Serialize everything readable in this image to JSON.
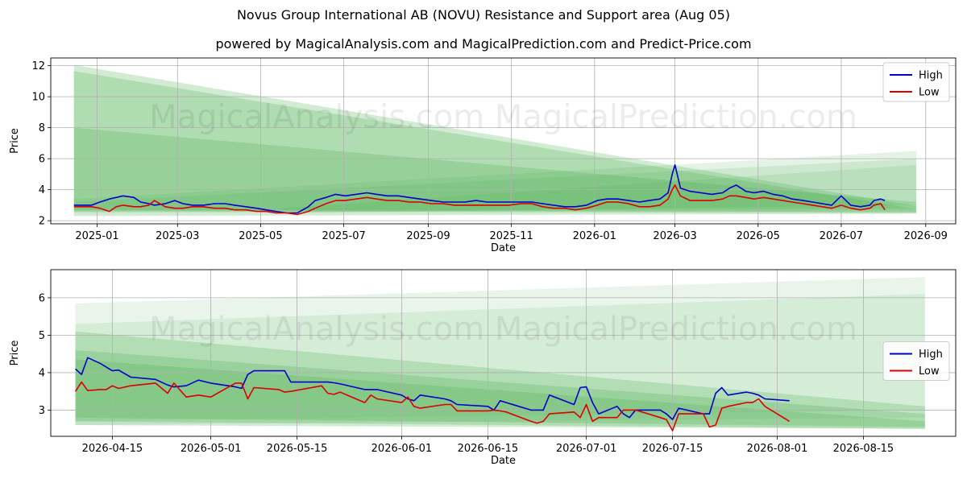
{
  "header": {
    "title": "Novus Group International AB (NOVU) Resistance and Support area (Aug 05)",
    "subtitle": "powered by MagicalAnalysis.com and MagicalPrediction.com and Predict-Price.com"
  },
  "watermark": "MagicalAnalysis.com   MagicalPrediction.com",
  "colors": {
    "high": "#0000cc",
    "low": "#dd0000",
    "band": "#4caf50",
    "grid": "#b0b0b0"
  },
  "chart_data": [
    {
      "type": "line",
      "title": "",
      "xlabel": "Date",
      "ylabel": "Price",
      "xlim": [
        "2024-11-28",
        "2026-09-23"
      ],
      "ylim": [
        1.8,
        12.5
      ],
      "x_ticks": [
        "2025-01",
        "2025-03",
        "2025-05",
        "2025-07",
        "2025-09",
        "2025-11",
        "2026-01",
        "2026-03",
        "2026-05",
        "2026-07",
        "2026-09"
      ],
      "y_ticks": [
        2,
        4,
        6,
        8,
        10,
        12
      ],
      "grid": true,
      "legend": "upper right",
      "bands": [
        {
          "x": [
            "2024-12-15",
            "2026-08-25"
          ],
          "upper": [
            12.05,
            2.95
          ],
          "lower": [
            2.3,
            2.45
          ],
          "opacity": 0.25
        },
        {
          "x": [
            "2024-12-15",
            "2026-08-25"
          ],
          "upper": [
            11.65,
            2.75
          ],
          "lower": [
            2.6,
            2.5
          ],
          "opacity": 0.25
        },
        {
          "x": [
            "2024-12-15",
            "2026-08-25"
          ],
          "upper": [
            8.0,
            3.2
          ],
          "lower": [
            2.7,
            2.55
          ],
          "opacity": 0.25
        },
        {
          "x": [
            "2024-12-15",
            "2026-08-25"
          ],
          "upper": [
            3.4,
            6.5
          ],
          "lower": [
            2.6,
            2.8
          ],
          "opacity": 0.15
        },
        {
          "x": [
            "2024-12-15",
            "2026-08-25"
          ],
          "upper": [
            3.2,
            6.0
          ],
          "lower": [
            2.5,
            2.7
          ],
          "opacity": 0.15
        },
        {
          "x": [
            "2025-05-15",
            "2026-08-25"
          ],
          "upper": [
            2.8,
            5.6
          ],
          "lower": [
            2.5,
            3.0
          ],
          "opacity": 0.15
        }
      ],
      "series": [
        {
          "name": "High",
          "x": [
            "2024-12-15",
            "2024-12-20",
            "2024-12-28",
            "2025-01-03",
            "2025-01-10",
            "2025-01-15",
            "2025-01-20",
            "2025-01-28",
            "2025-02-02",
            "2025-02-08",
            "2025-02-12",
            "2025-02-20",
            "2025-02-27",
            "2025-03-05",
            "2025-03-12",
            "2025-03-20",
            "2025-03-28",
            "2025-04-05",
            "2025-04-12",
            "2025-04-20",
            "2025-04-28",
            "2025-05-05",
            "2025-05-12",
            "2025-05-20",
            "2025-05-28",
            "2025-06-05",
            "2025-06-10",
            "2025-06-18",
            "2025-06-25",
            "2025-07-02",
            "2025-07-10",
            "2025-07-18",
            "2025-07-25",
            "2025-08-02",
            "2025-08-10",
            "2025-08-18",
            "2025-08-26",
            "2025-09-03",
            "2025-09-12",
            "2025-09-20",
            "2025-09-28",
            "2025-10-06",
            "2025-10-14",
            "2025-10-22",
            "2025-10-30",
            "2025-11-08",
            "2025-11-16",
            "2025-11-24",
            "2025-12-02",
            "2025-12-10",
            "2025-12-18",
            "2025-12-26",
            "2026-01-03",
            "2026-01-10",
            "2026-01-18",
            "2026-01-26",
            "2026-02-03",
            "2026-02-10",
            "2026-02-18",
            "2026-02-24",
            "2026-02-27",
            "2026-03-01",
            "2026-03-05",
            "2026-03-12",
            "2026-03-20",
            "2026-03-28",
            "2026-04-05",
            "2026-04-10",
            "2026-04-15",
            "2026-04-22",
            "2026-04-28",
            "2026-05-05",
            "2026-05-12",
            "2026-05-19",
            "2026-05-26",
            "2026-06-03",
            "2026-06-10",
            "2026-06-17",
            "2026-06-24",
            "2026-07-01",
            "2026-07-08",
            "2026-07-15",
            "2026-07-22",
            "2026-07-25",
            "2026-07-30",
            "2026-08-02"
          ],
          "values": [
            3.0,
            3.0,
            3.0,
            3.2,
            3.4,
            3.5,
            3.6,
            3.5,
            3.2,
            3.1,
            3.0,
            3.1,
            3.3,
            3.1,
            3.0,
            3.0,
            3.1,
            3.1,
            3.0,
            2.9,
            2.8,
            2.7,
            2.6,
            2.5,
            2.5,
            2.9,
            3.3,
            3.5,
            3.7,
            3.6,
            3.7,
            3.8,
            3.7,
            3.6,
            3.6,
            3.5,
            3.4,
            3.3,
            3.2,
            3.2,
            3.2,
            3.3,
            3.2,
            3.2,
            3.2,
            3.2,
            3.2,
            3.1,
            3.0,
            2.9,
            2.9,
            3.0,
            3.3,
            3.4,
            3.4,
            3.3,
            3.2,
            3.3,
            3.4,
            3.8,
            5.0,
            5.6,
            4.1,
            3.9,
            3.8,
            3.7,
            3.8,
            4.1,
            4.3,
            3.9,
            3.8,
            3.9,
            3.7,
            3.6,
            3.4,
            3.3,
            3.2,
            3.1,
            3.0,
            3.6,
            3.0,
            2.9,
            3.0,
            3.3,
            3.4,
            3.3
          ]
        },
        {
          "name": "Low",
          "x": [
            "2024-12-15",
            "2024-12-20",
            "2024-12-28",
            "2025-01-03",
            "2025-01-10",
            "2025-01-15",
            "2025-01-20",
            "2025-01-28",
            "2025-02-02",
            "2025-02-08",
            "2025-02-12",
            "2025-02-20",
            "2025-02-27",
            "2025-03-05",
            "2025-03-12",
            "2025-03-20",
            "2025-03-28",
            "2025-04-05",
            "2025-04-12",
            "2025-04-20",
            "2025-04-28",
            "2025-05-05",
            "2025-05-12",
            "2025-05-20",
            "2025-05-28",
            "2025-06-05",
            "2025-06-10",
            "2025-06-18",
            "2025-06-25",
            "2025-07-02",
            "2025-07-10",
            "2025-07-18",
            "2025-07-25",
            "2025-08-02",
            "2025-08-10",
            "2025-08-18",
            "2025-08-26",
            "2025-09-03",
            "2025-09-12",
            "2025-09-20",
            "2025-09-28",
            "2025-10-06",
            "2025-10-14",
            "2025-10-22",
            "2025-10-30",
            "2025-11-08",
            "2025-11-16",
            "2025-11-24",
            "2025-12-02",
            "2025-12-10",
            "2025-12-18",
            "2025-12-26",
            "2026-01-03",
            "2026-01-10",
            "2026-01-18",
            "2026-01-26",
            "2026-02-03",
            "2026-02-10",
            "2026-02-18",
            "2026-02-24",
            "2026-02-27",
            "2026-03-01",
            "2026-03-05",
            "2026-03-12",
            "2026-03-20",
            "2026-03-28",
            "2026-04-05",
            "2026-04-10",
            "2026-04-15",
            "2026-04-22",
            "2026-04-28",
            "2026-05-05",
            "2026-05-12",
            "2026-05-19",
            "2026-05-26",
            "2026-06-03",
            "2026-06-10",
            "2026-06-17",
            "2026-06-24",
            "2026-07-01",
            "2026-07-08",
            "2026-07-15",
            "2026-07-22",
            "2026-07-25",
            "2026-07-30",
            "2026-08-02"
          ],
          "values": [
            2.9,
            2.9,
            2.9,
            2.8,
            2.6,
            2.9,
            3.0,
            2.9,
            2.9,
            3.0,
            3.3,
            2.9,
            2.8,
            2.8,
            2.9,
            2.9,
            2.8,
            2.8,
            2.7,
            2.7,
            2.6,
            2.6,
            2.5,
            2.5,
            2.4,
            2.6,
            2.8,
            3.1,
            3.3,
            3.3,
            3.4,
            3.5,
            3.4,
            3.3,
            3.3,
            3.2,
            3.2,
            3.1,
            3.1,
            3.0,
            3.0,
            3.0,
            3.0,
            3.0,
            3.0,
            3.1,
            3.1,
            2.9,
            2.8,
            2.8,
            2.7,
            2.8,
            3.0,
            3.2,
            3.2,
            3.1,
            2.9,
            2.9,
            3.0,
            3.4,
            4.0,
            4.3,
            3.6,
            3.3,
            3.3,
            3.3,
            3.4,
            3.6,
            3.6,
            3.5,
            3.4,
            3.5,
            3.4,
            3.3,
            3.2,
            3.1,
            3.0,
            2.9,
            2.8,
            3.0,
            2.8,
            2.7,
            2.8,
            3.0,
            3.1,
            2.7
          ]
        }
      ]
    },
    {
      "type": "line",
      "title": "",
      "xlabel": "Date",
      "ylabel": "Price",
      "xlim": [
        "2026-04-05",
        "2026-08-30"
      ],
      "ylim": [
        2.3,
        6.75
      ],
      "x_ticks": [
        "2026-04-15",
        "2026-05-01",
        "2026-05-15",
        "2026-06-01",
        "2026-06-15",
        "2026-07-01",
        "2026-07-15",
        "2026-08-01",
        "2026-08-15"
      ],
      "y_ticks": [
        3,
        4,
        5,
        6
      ],
      "grid": true,
      "legend": "center right",
      "bands": [
        {
          "x": [
            "2026-04-09",
            "2026-08-25"
          ],
          "upper": [
            5.85,
            6.55
          ],
          "lower": [
            2.6,
            2.8
          ],
          "opacity": 0.12
        },
        {
          "x": [
            "2026-04-09",
            "2026-08-25"
          ],
          "upper": [
            5.3,
            6.1
          ],
          "lower": [
            2.7,
            3.0
          ],
          "opacity": 0.12
        },
        {
          "x": [
            "2026-04-09",
            "2026-08-25"
          ],
          "upper": [
            5.1,
            3.1
          ],
          "lower": [
            2.6,
            2.5
          ],
          "opacity": 0.25
        },
        {
          "x": [
            "2026-04-09",
            "2026-08-25"
          ],
          "upper": [
            4.6,
            2.9
          ],
          "lower": [
            2.7,
            2.5
          ],
          "opacity": 0.25
        },
        {
          "x": [
            "2026-04-09",
            "2026-08-25"
          ],
          "upper": [
            4.35,
            2.7
          ],
          "lower": [
            2.8,
            2.55
          ],
          "opacity": 0.25
        }
      ],
      "series": [
        {
          "name": "High",
          "x": [
            "2026-04-09",
            "2026-04-10",
            "2026-04-11",
            "2026-04-13",
            "2026-04-14",
            "2026-04-15",
            "2026-04-16",
            "2026-04-18",
            "2026-04-22",
            "2026-04-24",
            "2026-04-25",
            "2026-04-27",
            "2026-04-29",
            "2026-05-01",
            "2026-05-05",
            "2026-05-06",
            "2026-05-07",
            "2026-05-08",
            "2026-05-12",
            "2026-05-13",
            "2026-05-14",
            "2026-05-19",
            "2026-05-20",
            "2026-05-21",
            "2026-05-22",
            "2026-05-26",
            "2026-05-27",
            "2026-05-28",
            "2026-06-01",
            "2026-06-02",
            "2026-06-03",
            "2026-06-04",
            "2026-06-08",
            "2026-06-09",
            "2026-06-10",
            "2026-06-15",
            "2026-06-16",
            "2026-06-17",
            "2026-06-18",
            "2026-06-22",
            "2026-06-23",
            "2026-06-24",
            "2026-06-25",
            "2026-06-29",
            "2026-06-30",
            "2026-07-01",
            "2026-07-02",
            "2026-07-03",
            "2026-07-06",
            "2026-07-07",
            "2026-07-08",
            "2026-07-09",
            "2026-07-13",
            "2026-07-14",
            "2026-07-15",
            "2026-07-16",
            "2026-07-20",
            "2026-07-21",
            "2026-07-22",
            "2026-07-23",
            "2026-07-24",
            "2026-07-27",
            "2026-07-28",
            "2026-07-29",
            "2026-07-30",
            "2026-08-03"
          ],
          "values": [
            4.1,
            3.95,
            4.4,
            4.25,
            4.15,
            4.05,
            4.07,
            3.88,
            3.82,
            3.67,
            3.62,
            3.65,
            3.8,
            3.72,
            3.62,
            3.58,
            3.95,
            4.05,
            4.05,
            4.05,
            3.75,
            3.75,
            3.75,
            3.73,
            3.7,
            3.55,
            3.55,
            3.55,
            3.4,
            3.3,
            3.25,
            3.4,
            3.3,
            3.25,
            3.15,
            3.1,
            3.0,
            3.25,
            3.2,
            3.0,
            3.0,
            3.0,
            3.4,
            3.15,
            3.6,
            3.62,
            3.2,
            2.9,
            3.1,
            2.9,
            2.8,
            3.0,
            3.0,
            2.9,
            2.75,
            3.05,
            2.9,
            2.9,
            3.45,
            3.6,
            3.4,
            3.48,
            3.45,
            3.4,
            3.3,
            3.25
          ]
        },
        {
          "name": "Low",
          "x": [
            "2026-04-09",
            "2026-04-10",
            "2026-04-11",
            "2026-04-13",
            "2026-04-14",
            "2026-04-15",
            "2026-04-16",
            "2026-04-18",
            "2026-04-22",
            "2026-04-24",
            "2026-04-25",
            "2026-04-27",
            "2026-04-29",
            "2026-05-01",
            "2026-05-05",
            "2026-05-06",
            "2026-05-07",
            "2026-05-08",
            "2026-05-12",
            "2026-05-13",
            "2026-05-14",
            "2026-05-19",
            "2026-05-20",
            "2026-05-21",
            "2026-05-22",
            "2026-05-26",
            "2026-05-27",
            "2026-05-28",
            "2026-06-01",
            "2026-06-02",
            "2026-06-03",
            "2026-06-04",
            "2026-06-08",
            "2026-06-09",
            "2026-06-10",
            "2026-06-15",
            "2026-06-16",
            "2026-06-17",
            "2026-06-18",
            "2026-06-22",
            "2026-06-23",
            "2026-06-24",
            "2026-06-25",
            "2026-06-29",
            "2026-06-30",
            "2026-07-01",
            "2026-07-02",
            "2026-07-03",
            "2026-07-06",
            "2026-07-07",
            "2026-07-08",
            "2026-07-09",
            "2026-07-13",
            "2026-07-14",
            "2026-07-15",
            "2026-07-16",
            "2026-07-20",
            "2026-07-21",
            "2026-07-22",
            "2026-07-23",
            "2026-07-24",
            "2026-07-27",
            "2026-07-28",
            "2026-07-29",
            "2026-07-30",
            "2026-08-03"
          ],
          "values": [
            3.5,
            3.75,
            3.52,
            3.55,
            3.55,
            3.65,
            3.58,
            3.65,
            3.72,
            3.45,
            3.72,
            3.35,
            3.4,
            3.35,
            3.72,
            3.72,
            3.3,
            3.6,
            3.55,
            3.48,
            3.5,
            3.65,
            3.45,
            3.42,
            3.48,
            3.2,
            3.4,
            3.3,
            3.2,
            3.35,
            3.1,
            3.05,
            3.15,
            3.15,
            2.98,
            2.98,
            3.0,
            2.98,
            2.95,
            2.7,
            2.65,
            2.7,
            2.9,
            2.95,
            2.8,
            3.15,
            2.7,
            2.8,
            2.8,
            3.0,
            3.0,
            3.0,
            2.8,
            2.75,
            2.45,
            2.9,
            2.9,
            2.55,
            2.6,
            3.05,
            3.1,
            3.2,
            3.2,
            3.3,
            3.1,
            2.7
          ]
        }
      ]
    }
  ]
}
